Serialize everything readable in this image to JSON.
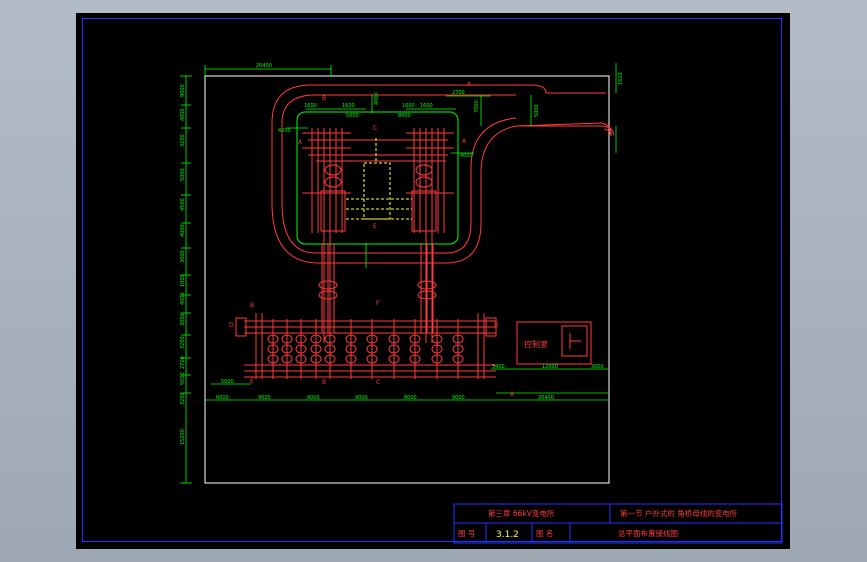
{
  "drawing": {
    "dims_top": {
      "overall_width": "20400",
      "left_a": "1600",
      "left_b": "1600",
      "left_mid": "5000",
      "left_c": "4000",
      "right_a": "1600",
      "right_b": "1600",
      "right_mid": "8000",
      "gap_right": "2700",
      "vert_right": "7000",
      "road_right": "5000",
      "far_right_v": "1610",
      "bay_left": "4000",
      "bay_right": "4000"
    },
    "dims_left": [
      "9000",
      "4000",
      "3200",
      "5000",
      "4500",
      "4000",
      "3000",
      "1000",
      "4000",
      "3000",
      "3200",
      "2700",
      "5000",
      "3200",
      "15200"
    ],
    "dims_bottom": {
      "seg1": "6000",
      "seg2": "9000",
      "seg3": "8000",
      "seg4": "9000",
      "seg5": "8000",
      "seg6": "9000",
      "left_small": "5000",
      "right_a": "5400",
      "right_b": "12000",
      "right_c": "3000",
      "right_total": "20400"
    },
    "labels": {
      "b_top": "B",
      "c_top": "C",
      "a_right": "A",
      "a_left": "A",
      "e_top": "E",
      "b_bus_left": "B",
      "f_bus": "F",
      "d_left": "D",
      "d_right": "D",
      "e_bottom": "E",
      "b_bottom": "B",
      "c_bottom": "C",
      "a_bottom": "A",
      "a_top_right": "A"
    },
    "control_room": "控制室"
  },
  "title_block": {
    "chapter": "第三章   66kV变电所",
    "section": "第一节  户外式的 角桥母线的变电所",
    "fig_no_label": "图 号",
    "fig_no": "3.1.2",
    "fig_name_label": "图 名",
    "fig_name": "总平面布置接线图"
  },
  "colors": {
    "frame": "#1f33ff",
    "equipment": "#ff3a3a",
    "dimension": "#00ff00",
    "outline": "#ffffff",
    "dashed": "#ffff33"
  }
}
